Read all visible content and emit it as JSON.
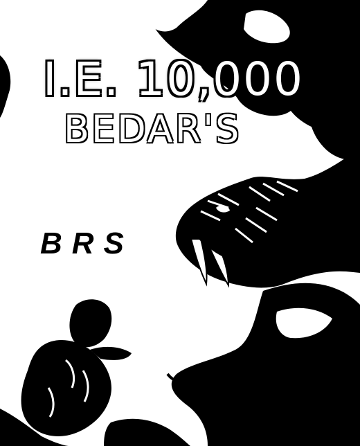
{
  "poster": {
    "title": "I.E. 10,000",
    "subtitle": "BEDAR'S",
    "mark": "BRS"
  },
  "colors": {
    "ink": "#000000",
    "paper": "#ffffff"
  },
  "illustration": {
    "subject": "sabre-tooth-tiger-and-hunter",
    "style": "high-contrast black and white"
  }
}
